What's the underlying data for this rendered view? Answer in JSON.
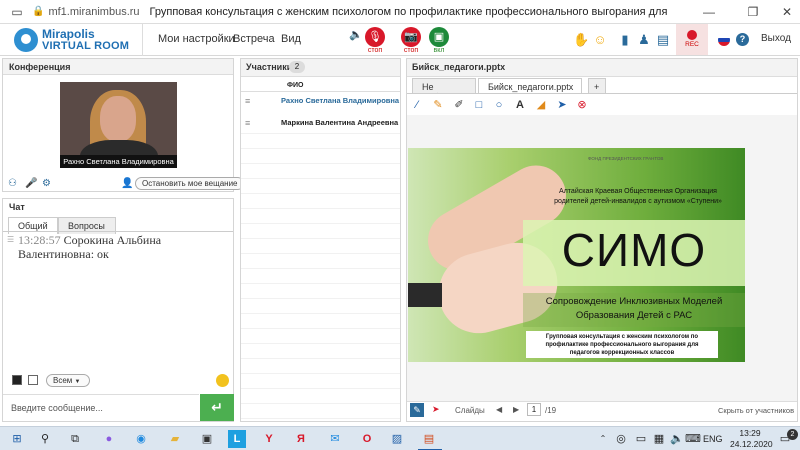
{
  "browser": {
    "url": "mf1.miranimbus.ru",
    "title": "Групповая консультация с женским психологом по профилактике профессионального выгорания для педагог..."
  },
  "app": {
    "logo_line1": "Mirapolis",
    "logo_line2": "VIRTUAL ROOM",
    "menu": [
      "Мои настройки",
      "Встреча",
      "Вид"
    ],
    "mic_label": "стоп",
    "cam_label": "стоп",
    "screen_label": "вкл",
    "rec_label": "REC",
    "exit_label": "Выход"
  },
  "conference": {
    "title": "Конференция",
    "video_caption": "Рахно Светлана  Владимировна",
    "stop_button": "Остановить мое вещание"
  },
  "chat": {
    "title": "Чат",
    "tabs": [
      "Общий",
      "Вопросы"
    ],
    "message_time": "13:28:57",
    "message_author": "Сорокина Альбина Валентиновна",
    "message_text": "ок",
    "recipient": "Всем",
    "input_placeholder": "Введите сообщение..."
  },
  "participants": {
    "title": "Участники",
    "count": "2",
    "column_header": "ФИО",
    "rows": [
      "Рахно Светлана  Владимировна",
      "Маркина Валентина  Андреевна"
    ]
  },
  "presentation": {
    "tabs": [
      "Не выбрано",
      "Бийск_педагоги.pptx",
      "+"
    ],
    "file_title": "Бийск_педагоги.pptx",
    "slides_label": "Слайды",
    "page_current": "1",
    "page_total": "/19",
    "hide_label": "Скрыть от участников"
  },
  "slide": {
    "logo_text": "ФОНД ПРЕЗИДЕНТСКИХ ГРАНТОВ",
    "org_line1": "Алтайская Краевая Общественная Организация",
    "org_line2": "родителей детей-инвалидов с аутизмом «Ступени»",
    "big": "СИМО",
    "sub1": "Сопровождение Инклюзивных Моделей",
    "sub2": "Образования Детей с РАС",
    "caption": "Групповая консультация с женским психологом по профилактике профессионального выгорания для педагогов коррекционных классов"
  },
  "taskbar": {
    "lang": "ENG",
    "time": "13:29",
    "date": "24.12.2020",
    "notif": "2"
  }
}
